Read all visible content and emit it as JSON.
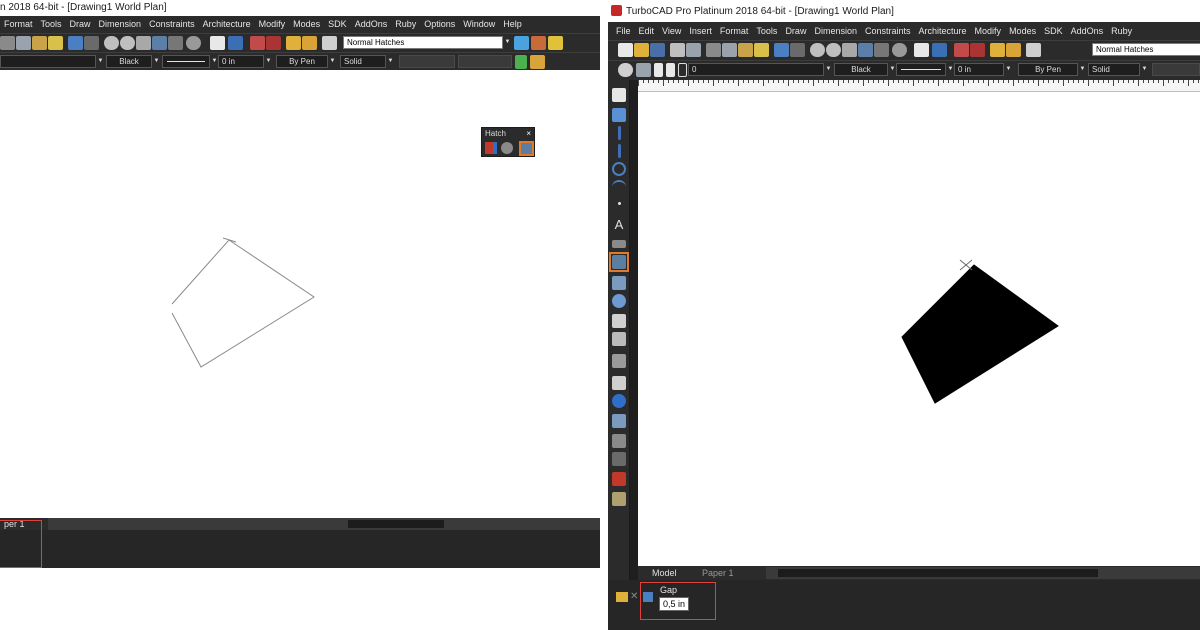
{
  "colors": {
    "dark_chrome": "#2b2b2b",
    "canvas": "#ffffff",
    "highlight_red": "#e0413a",
    "highlight_orange": "#e07a2a",
    "fill": "#000000"
  },
  "left": {
    "title": "n 2018 64-bit - [Drawing1 World Plan]",
    "menu": [
      "Format",
      "Tools",
      "Draw",
      "Dimension",
      "Constraints",
      "Architecture",
      "Modify",
      "Modes",
      "SDK",
      "AddOns",
      "Ruby",
      "Options",
      "Window",
      "Help"
    ],
    "hatch_style": "Normal Hatches",
    "color_value": "Black",
    "width_value": "0 in",
    "pen_value": "By Pen",
    "line_style": "Solid",
    "hatch_palette": {
      "title": "Hatch",
      "close": "×",
      "icons": [
        "hatch-pattern-icon",
        "fill-icon",
        "hatch-tool-icon"
      ]
    },
    "tab_partial": "per 1"
  },
  "right": {
    "title": "TurboCAD Pro Platinum 2018 64-bit - [Drawing1 World Plan]",
    "menu": [
      "File",
      "Edit",
      "View",
      "Insert",
      "Format",
      "Tools",
      "Draw",
      "Dimension",
      "Constraints",
      "Architecture",
      "Modify",
      "Modes",
      "SDK",
      "AddOns",
      "Ruby"
    ],
    "hatch_style": "Normal Hatches",
    "layer_value": "0",
    "color_value": "Black",
    "width_value": "0 in",
    "pen_value": "By Pen",
    "line_style": "Solid",
    "tabs": [
      "Model",
      "Paper 1"
    ],
    "inspector": {
      "label": "Gap",
      "value": "0,5 in"
    },
    "draw_tools": [
      "select-icon",
      "edit-tool-icon",
      "line-icon",
      "polyline-icon",
      "circle-icon",
      "arc-icon",
      "point-icon",
      "text-icon",
      "dimension-icon",
      "hatch-icon",
      "insert-icon",
      "rotate-icon",
      "eraser-icon",
      "grid-icon",
      "zoom-icon",
      "paint-icon",
      "gear-icon",
      "table-icon",
      "block-icon",
      "layer-icon",
      "snap-icon"
    ]
  },
  "shapes": {
    "left_outline": "quadrilateral",
    "right_filled": "quadrilateral"
  }
}
